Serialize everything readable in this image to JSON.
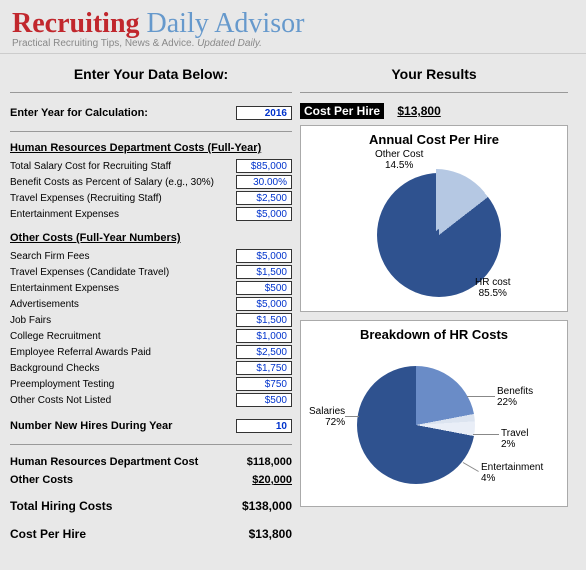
{
  "header": {
    "brand_a": "Recruiting",
    "brand_b": "Daily Advisor",
    "tagline_a": "Practical Recruiting Tips, News & Advice.",
    "tagline_b": "Updated Daily."
  },
  "left": {
    "title": "Enter Your Data Below:",
    "year_label": "Enter Year for Calculation:",
    "year_value": "2016",
    "hr_section": "Human Resources Department Costs (Full-Year)",
    "hr_rows": [
      {
        "label": "Total Salary Cost for Recruiting Staff",
        "value": "$85,000"
      },
      {
        "label": "Benefit Costs as Percent of Salary (e.g., 30%)",
        "value": "30.00%"
      },
      {
        "label": "Travel Expenses (Recruiting Staff)",
        "value": "$2,500"
      },
      {
        "label": "Entertainment Expenses",
        "value": "$5,000"
      }
    ],
    "other_section": "Other Costs (Full-Year Numbers)",
    "other_rows": [
      {
        "label": "Search Firm Fees",
        "value": "$5,000"
      },
      {
        "label": "Travel Expenses (Candidate Travel)",
        "value": "$1,500"
      },
      {
        "label": "Entertainment Expenses",
        "value": "$500"
      },
      {
        "label": "Advertisements",
        "value": "$5,000"
      },
      {
        "label": "Job Fairs",
        "value": "$1,500"
      },
      {
        "label": "College Recruitment",
        "value": "$1,000"
      },
      {
        "label": "Employee Referral Awards Paid",
        "value": "$2,500"
      },
      {
        "label": "Background Checks",
        "value": "$1,750"
      },
      {
        "label": "Preemployment Testing",
        "value": "$750"
      },
      {
        "label": "Other Costs Not Listed",
        "value": "$500"
      }
    ],
    "hires_label": "Number New Hires During Year",
    "hires_value": "10",
    "totals": {
      "hr_label": "Human Resources Department Cost",
      "hr_value": "$118,000",
      "other_label": "Other Costs",
      "other_value": "$20,000",
      "total_label": "Total Hiring Costs",
      "total_value": "$138,000",
      "cph_label": "Cost Per Hire",
      "cph_value": "$13,800"
    }
  },
  "right": {
    "title": "Your Results",
    "cph_label": "Cost Per Hire",
    "cph_value": "$13,800",
    "chart1_title": "Annual Cost Per Hire",
    "chart1_labels": {
      "other": "Other Cost",
      "other_pct": "14.5%",
      "hr": "HR cost",
      "hr_pct": "85.5%"
    },
    "chart2_title": "Breakdown of HR Costs",
    "chart2_labels": {
      "benefits": "Benefits",
      "benefits_pct": "22%",
      "travel": "Travel",
      "travel_pct": "2%",
      "ent": "Entertainment",
      "ent_pct": "4%",
      "sal": "Salaries",
      "sal_pct": "72%"
    }
  },
  "chart_data": [
    {
      "type": "pie",
      "title": "Annual Cost Per Hire",
      "series": [
        {
          "name": "Other Cost",
          "value": 14.5
        },
        {
          "name": "HR cost",
          "value": 85.5
        }
      ]
    },
    {
      "type": "pie",
      "title": "Breakdown of HR Costs",
      "series": [
        {
          "name": "Benefits",
          "value": 22
        },
        {
          "name": "Travel",
          "value": 2
        },
        {
          "name": "Entertainment",
          "value": 4
        },
        {
          "name": "Salaries",
          "value": 72
        }
      ]
    }
  ]
}
